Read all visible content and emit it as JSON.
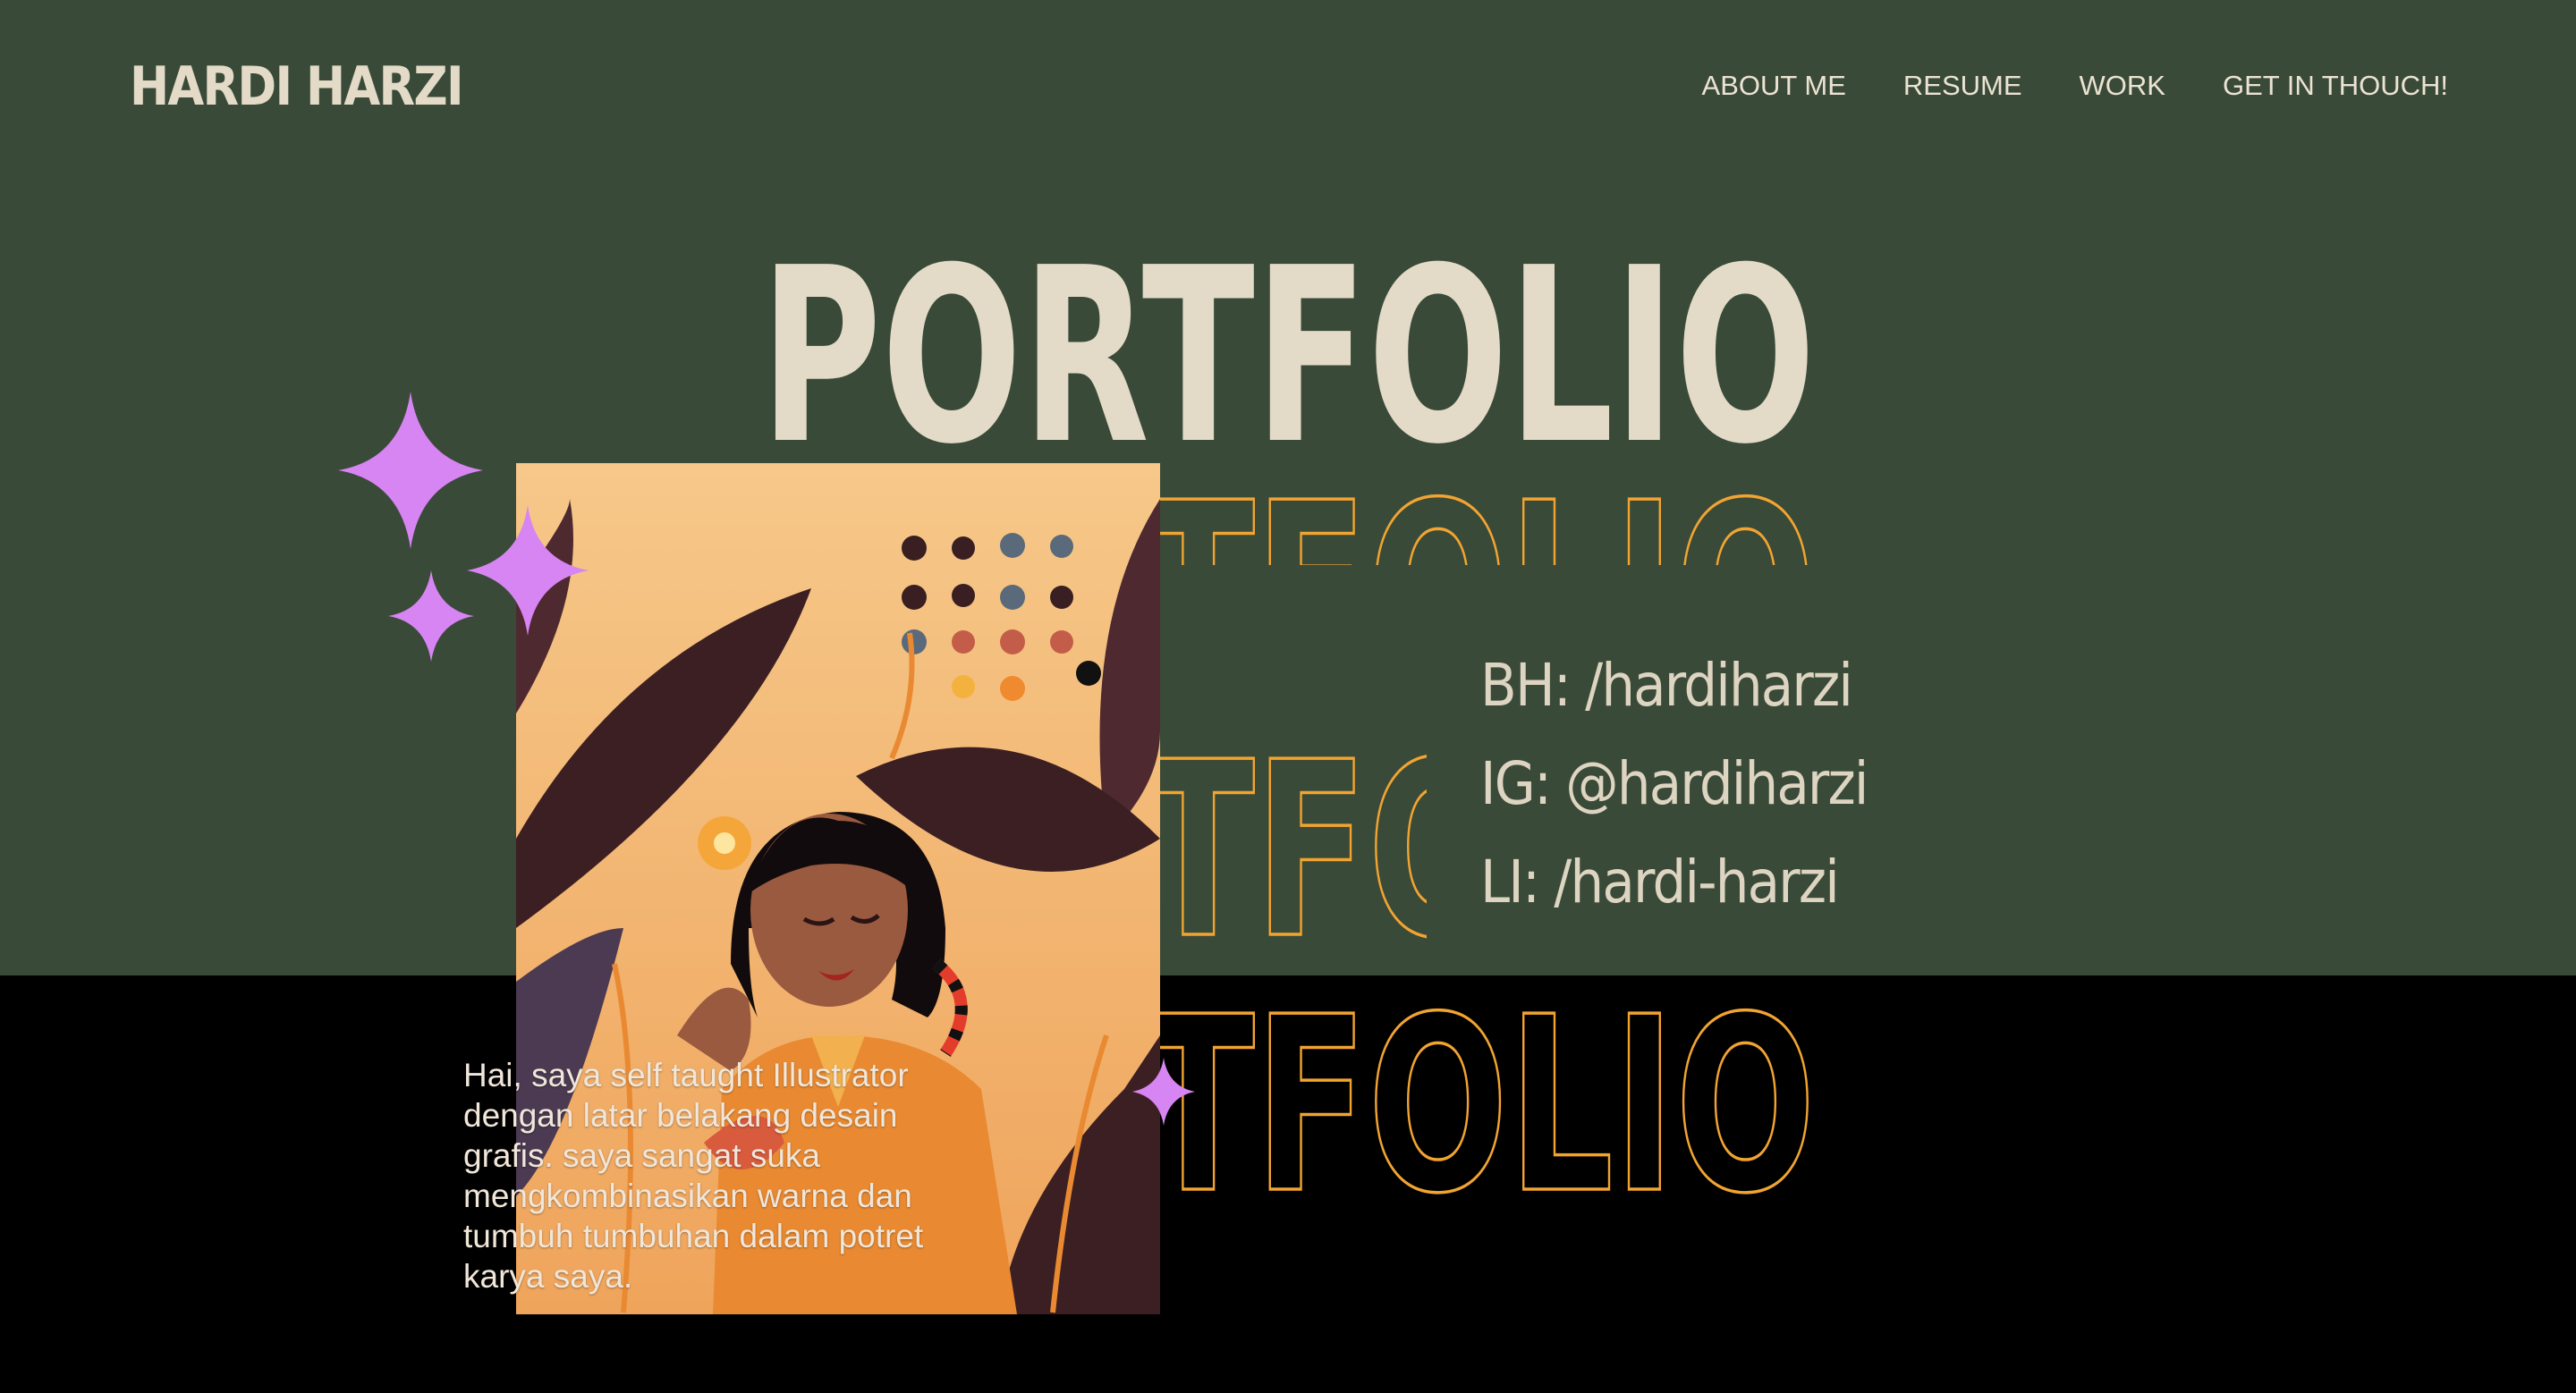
{
  "header": {
    "logo_text": "HARDI HARZI",
    "nav": [
      {
        "label": "ABOUT ME"
      },
      {
        "label": "RESUME"
      },
      {
        "label": "WORK"
      },
      {
        "label": "GET IN THOUCH!"
      }
    ]
  },
  "hero": {
    "title": "PORTFOLIO",
    "outline_rows": [
      "PORTFOLIO",
      "PORTFOLIO",
      "PORTFOLIO"
    ]
  },
  "contact": {
    "behance": "BH: /hardiharzi",
    "instagram": "IG: @hardiharzi",
    "linkedin": "LI: /hardi-harzi"
  },
  "bio": {
    "text": "Hai, saya self taught Illustrator dengan latar belakang desain grafis. saya sangat suka mengkombinasikan warna dan tumbuh tumbuhan dalam potret karya saya."
  },
  "colors": {
    "green_band": "#394a38",
    "cream": "#e3dac7",
    "outline_orange": "#f2a431",
    "sparkle": "#d685f2",
    "background": "#000000"
  },
  "icons": [
    "sparkle-large-icon",
    "sparkle-medium-icon",
    "sparkle-small-icon",
    "sparkle-right-icon"
  ]
}
